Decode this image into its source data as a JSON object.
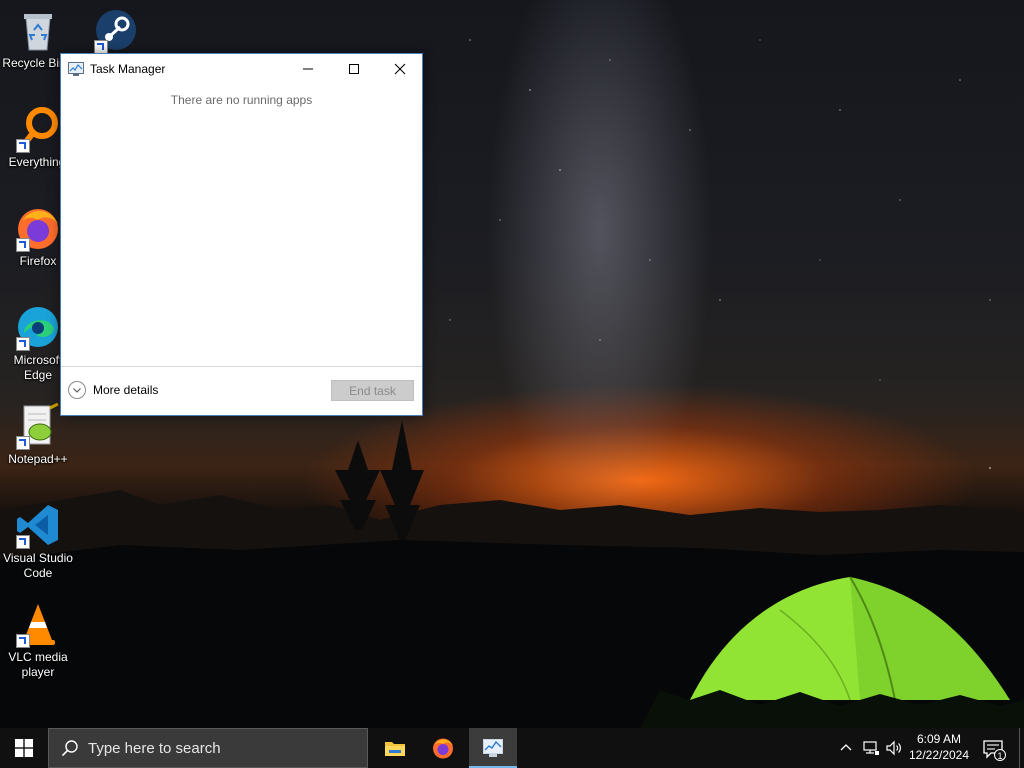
{
  "desktop": {
    "icons": [
      {
        "label": "Recycle Bin",
        "icon": "recycle-bin-icon"
      },
      {
        "label": "Steam",
        "icon": "steam-icon"
      },
      {
        "label": "Everything",
        "icon": "everything-search-icon"
      },
      {
        "label": "Firefox",
        "icon": "firefox-icon"
      },
      {
        "label": "Microsoft Edge",
        "icon": "edge-icon"
      },
      {
        "label": "Notepad++",
        "icon": "notepadpp-icon"
      },
      {
        "label": "Visual Studio Code",
        "icon": "vscode-icon"
      },
      {
        "label": "VLC media player",
        "icon": "vlc-icon"
      }
    ]
  },
  "task_manager": {
    "title": "Task Manager",
    "empty_message": "There are no running apps",
    "more_details_label": "More details",
    "end_task_label": "End task",
    "end_task_enabled": false
  },
  "taskbar": {
    "search_placeholder": "Type here to search",
    "pinned_apps": [
      {
        "name": "File Explorer",
        "icon": "folder-icon",
        "active": false
      },
      {
        "name": "Firefox",
        "icon": "firefox-icon",
        "active": false
      },
      {
        "name": "Task Manager",
        "icon": "task-manager-icon",
        "active": true
      }
    ],
    "clock": {
      "time": "6:09 AM",
      "date": "12/22/2024"
    },
    "notification_count": "1"
  },
  "colors": {
    "taskbar_bg": "#101010",
    "accent": "#76b9ed",
    "window_border": "#4a7ebb"
  }
}
